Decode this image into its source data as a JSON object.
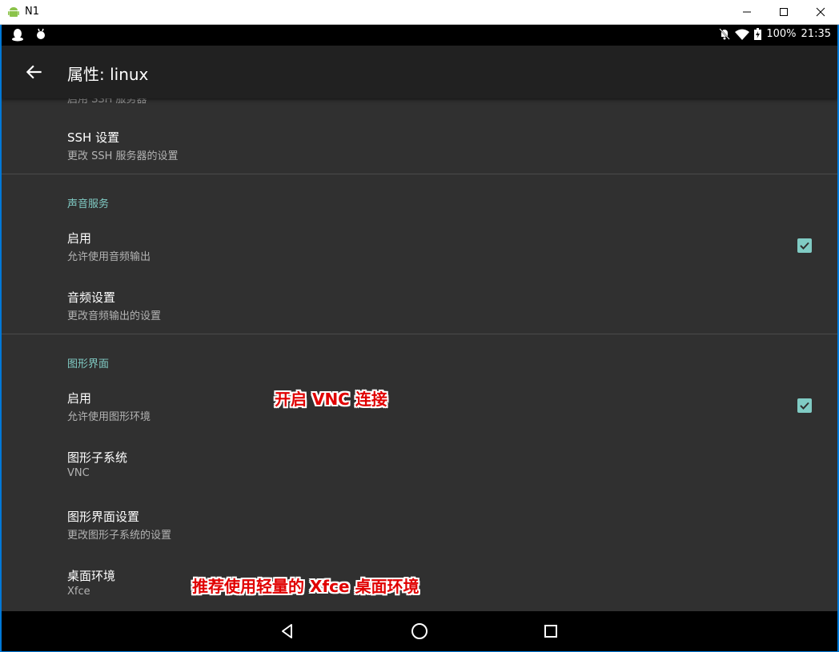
{
  "window": {
    "title": "N1"
  },
  "status_bar": {
    "battery": "100%",
    "time": "21:35"
  },
  "app_bar": {
    "title": "属性: linux"
  },
  "prefs": {
    "partial_top": "启用 SSH 服务器",
    "ssh_settings": {
      "title": "SSH 设置",
      "summary": "更改 SSH 服务器的设置"
    },
    "audio_category": "声音服务",
    "audio_enable": {
      "title": "启用",
      "summary": "允许使用音频输出",
      "checked": true
    },
    "audio_settings": {
      "title": "音频设置",
      "summary": "更改音频输出的设置"
    },
    "gui_category": "图形界面",
    "gui_enable": {
      "title": "启用",
      "summary": "允许使用图形环境",
      "checked": true
    },
    "gui_subsystem": {
      "title": "图形子系统",
      "summary": "VNC"
    },
    "gui_settings": {
      "title": "图形界面设置",
      "summary": "更改图形子系统的设置"
    },
    "desktop_env": {
      "title": "桌面环境",
      "summary": "Xfce"
    }
  },
  "annotations": {
    "vnc_note": "开启 VNC 连接",
    "xfce_note": "推荐使用轻量的 Xfce 桌面环境"
  },
  "colors": {
    "accent": "#80cbc4",
    "background": "#303030",
    "annotation": "#e00000"
  }
}
